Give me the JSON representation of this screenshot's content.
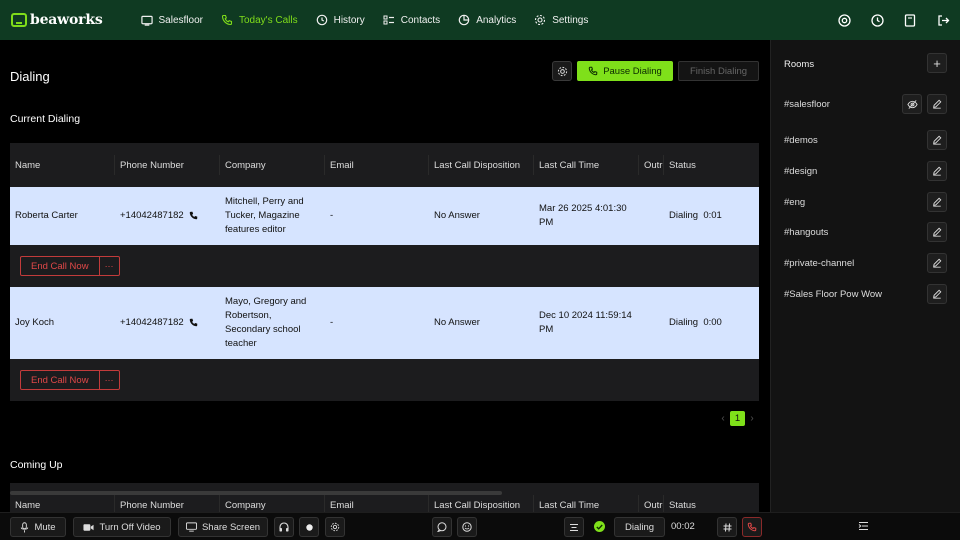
{
  "app": {
    "logo_text": "beaworks"
  },
  "nav": {
    "items": [
      {
        "label": "Salesfloor",
        "icon": "salesfloor-icon"
      },
      {
        "label": "Today's Calls",
        "icon": "phone-icon",
        "active": true
      },
      {
        "label": "History",
        "icon": "history-icon"
      },
      {
        "label": "Contacts",
        "icon": "contacts-icon"
      },
      {
        "label": "Analytics",
        "icon": "analytics-icon"
      },
      {
        "label": "Settings",
        "icon": "gear-icon"
      }
    ]
  },
  "header": {
    "title": "Dialing",
    "pause_label": "Pause Dialing",
    "finish_label": "Finish Dialing"
  },
  "current": {
    "title": "Current Dialing",
    "columns": [
      "Name",
      "Phone Number",
      "Company",
      "Email",
      "Last Call Disposition",
      "Last Call Time",
      "Outreach label",
      "Status"
    ],
    "rows": [
      {
        "name": "Roberta Carter",
        "phone": "+14042487182",
        "company_lines": [
          "Mitchell, Perry and",
          "Tucker, Magazine",
          "features editor"
        ],
        "email": "-",
        "disposition": "No Answer",
        "time_lines": [
          "Mar 26 2025 4:01:30",
          "PM"
        ],
        "status": "Dialing",
        "duration": "0:01",
        "action_label": "End Call Now",
        "more_label": "···"
      },
      {
        "name": "Joy Koch",
        "phone": "+14042487182",
        "company_lines": [
          "Mayo, Gregory and",
          "Robertson,",
          "Secondary school",
          "teacher"
        ],
        "email": "-",
        "disposition": "No Answer",
        "time_lines": [
          "Dec 10 2024 11:59:14",
          "PM"
        ],
        "status": "Dialing",
        "duration": "0:00",
        "action_label": "End Call Now",
        "more_label": "···"
      }
    ]
  },
  "pagination": {
    "prev": "‹",
    "page": "1",
    "next": "›"
  },
  "coming_up": {
    "title": "Coming Up",
    "columns": [
      "Name",
      "Phone Number",
      "Company",
      "Email",
      "Last Call Disposition",
      "Last Call Time",
      "Outreach label",
      "Status"
    ]
  },
  "rooms": {
    "title": "Rooms",
    "add_label": "+",
    "items": [
      "#salesfloor",
      "#demos",
      "#design",
      "#eng",
      "#hangouts",
      "#private-channel",
      "#Sales Floor Pow Wow"
    ]
  },
  "bottom": {
    "mute": "Mute",
    "video": "Turn Off Video",
    "share": "Share Screen",
    "dialing": "Dialing",
    "timer": "00:02"
  },
  "colors": {
    "accent": "#7fe01a",
    "nav_bg": "#0f3a22",
    "row_bg": "#d6e4ff",
    "danger": "#e04848"
  }
}
